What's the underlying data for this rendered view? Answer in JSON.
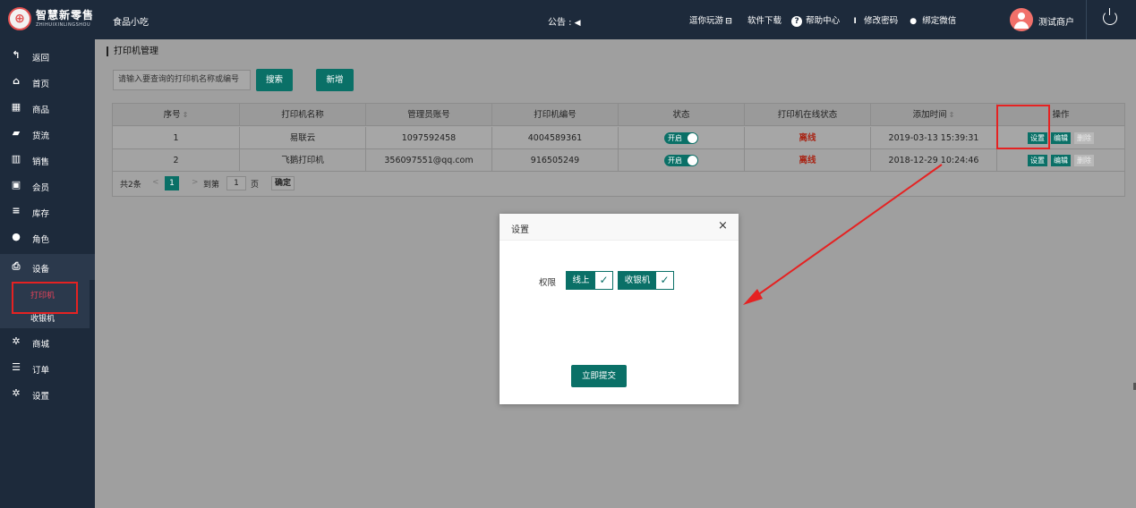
{
  "brand": {
    "logo_char": "⊕",
    "name": "智慧新零售",
    "subtitle": "ZHIHUIXINLINGSHOU"
  },
  "header": {
    "shop_name": "食品小吃",
    "notice_label": "公告 :",
    "notice_icon": "speaker-icon",
    "links": [
      {
        "label": "逗你玩游",
        "icon": "promo-icon"
      },
      {
        "label": "软件下载",
        "icon": "download-icon"
      },
      {
        "label": "帮助中心",
        "icon": "help-icon"
      },
      {
        "label": "修改密码",
        "icon": "thermometer-icon"
      },
      {
        "label": "绑定微信",
        "icon": "wechat-icon"
      }
    ],
    "user_name": "测试商户"
  },
  "sidebar": {
    "items": [
      {
        "label": "返回",
        "icon": "back-icon"
      },
      {
        "label": "首页",
        "icon": "home-icon"
      },
      {
        "label": "商品",
        "icon": "grid-icon"
      },
      {
        "label": "货流",
        "icon": "truck-icon"
      },
      {
        "label": "销售",
        "icon": "bar-chart-icon"
      },
      {
        "label": "会员",
        "icon": "id-card-icon"
      },
      {
        "label": "库存",
        "icon": "database-icon"
      },
      {
        "label": "角色",
        "icon": "user-icon"
      },
      {
        "label": "设备",
        "icon": "printer-icon"
      },
      {
        "label": "商城",
        "icon": "gear-icon"
      },
      {
        "label": "订单",
        "icon": "list-icon"
      },
      {
        "label": "设置",
        "icon": "gear-icon"
      }
    ],
    "sub_items": [
      {
        "label": "打印机"
      },
      {
        "label": "收银机"
      }
    ]
  },
  "page": {
    "breadcrumb": "打印机管理",
    "search_placeholder": "请输入要查询的打印机名称或编号",
    "search_button": "搜索",
    "add_button": "新增"
  },
  "table": {
    "headers": [
      "序号",
      "打印机名称",
      "管理员账号",
      "打印机编号",
      "状态",
      "打印机在线状态",
      "添加时间",
      "操作"
    ],
    "rows": [
      {
        "index": "1",
        "name": "易联云",
        "account": "1097592458",
        "code": "4004589361",
        "status": "开启",
        "online": "离线",
        "added": "2019-03-13 15:39:31"
      },
      {
        "index": "2",
        "name": "飞鹅打印机",
        "account": "356097551@qq.com",
        "code": "916505249",
        "status": "开启",
        "online": "离线",
        "added": "2018-12-29 10:24:46"
      }
    ],
    "actions": {
      "settings": "设置",
      "edit": "编辑",
      "delete": "删除"
    }
  },
  "pager": {
    "total": "共2条",
    "prev": "<",
    "current": "1",
    "next": ">",
    "goto_label": "到第",
    "goto_value": "1",
    "page_unit": "页",
    "confirm": "确定"
  },
  "dialog": {
    "title": "设置",
    "close": "×",
    "permission_label": "权限",
    "permissions": [
      {
        "label": "线上",
        "checked": true
      },
      {
        "label": "收银机",
        "checked": true
      }
    ],
    "check_mark": "✓",
    "submit": "立即提交"
  },
  "colors": {
    "primary": "#0a7067",
    "sidebar": "#1d2a3b",
    "offline": "#a82414",
    "highlight": "#e52222"
  }
}
